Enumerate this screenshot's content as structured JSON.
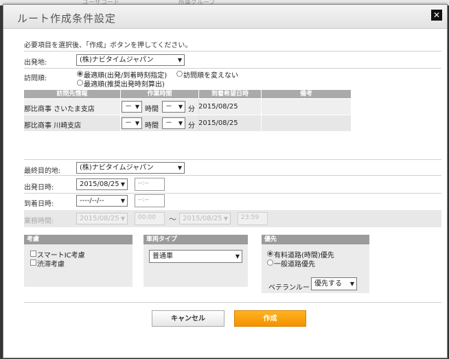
{
  "background": {
    "col_a": "ユーザコード",
    "col_b": "所属グループ"
  },
  "dialog": {
    "title": "ルート作成条件設定",
    "close_glyph": "✕",
    "instruction": "必要項目を選択後、「作成」ボタンを押してください。"
  },
  "departure": {
    "label": "出発地:",
    "value": "(株)ナビタイムジャパン"
  },
  "visit_order": {
    "label": "訪問順:",
    "options": [
      {
        "label": "最適順(出発/到着時刻指定)",
        "selected": true
      },
      {
        "label": "訪問順を変えない",
        "selected": false
      },
      {
        "label": "最適順(推奨出発時刻算出)",
        "selected": false
      }
    ]
  },
  "visit_table": {
    "headers": [
      "訪問先情報",
      "作業時間",
      "到着希望日時",
      "備考"
    ],
    "rows": [
      {
        "name": "那比商事 さいたま支店",
        "hour": "－",
        "hour_unit": "時間",
        "min": "－",
        "min_unit": "分",
        "date": "2015/08/25",
        "note": ""
      },
      {
        "name": "那比商事 川崎支店",
        "hour": "－",
        "hour_unit": "時間",
        "min": "－",
        "min_unit": "分",
        "date": "2015/08/25",
        "note": ""
      }
    ]
  },
  "final_destination": {
    "label": "最終目的地:",
    "value": "(株)ナビタイムジャパン"
  },
  "departure_time": {
    "label": "出発日時:",
    "date": "2015/08/25",
    "time_placeholder": "--:--"
  },
  "arrival_time": {
    "label": "到着日時:",
    "date": "----/--/--",
    "time_placeholder": "--:--"
  },
  "business_hours": {
    "label": "業務時間:",
    "start_date": "2015/08/25",
    "start_time": "00:00",
    "separator": "～",
    "end_date": "2015/08/25",
    "end_time": "23:59"
  },
  "consider_panel": {
    "title": "考慮",
    "options": [
      {
        "label": "スマートIC考慮",
        "checked": false
      },
      {
        "label": "渋滞考慮",
        "checked": false
      }
    ]
  },
  "vehicle_panel": {
    "title": "車両タイプ",
    "value": "普通車"
  },
  "priority_panel": {
    "title": "優先",
    "options": [
      {
        "label": "有料道路(時間)優先",
        "selected": true
      },
      {
        "label": "一般道路優先",
        "selected": false
      }
    ],
    "veteran_label": "ベテランルート",
    "veteran_value": "優先する"
  },
  "buttons": {
    "cancel": "キャンセル",
    "create": "作成"
  },
  "colors": {
    "create_button": "#f39200",
    "table_header": "#aaaaaa",
    "panel_header": "#9b9b9b"
  }
}
